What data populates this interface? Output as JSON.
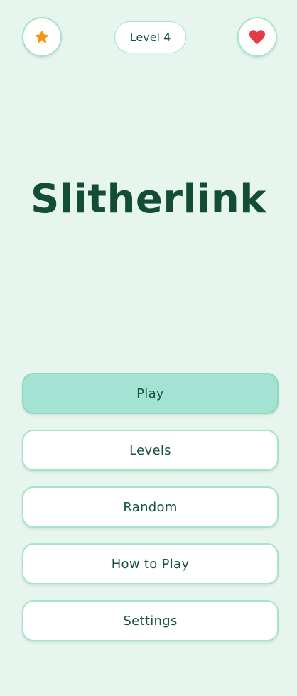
{
  "header": {
    "favorites_icon": "star-icon",
    "level_label": "Level 4",
    "lives_icon": "heart-icon"
  },
  "title": "Slitherlink",
  "menu": {
    "play_label": "Play",
    "levels_label": "Levels",
    "random_label": "Random",
    "how_to_play_label": "How to Play",
    "settings_label": "Settings"
  },
  "colors": {
    "background": "#e6f5ee",
    "accent_border": "#a6e3c9",
    "primary_button": "#a4e3d3",
    "text": "#17533d",
    "star": "#f7940f",
    "heart": "#e63b46"
  }
}
